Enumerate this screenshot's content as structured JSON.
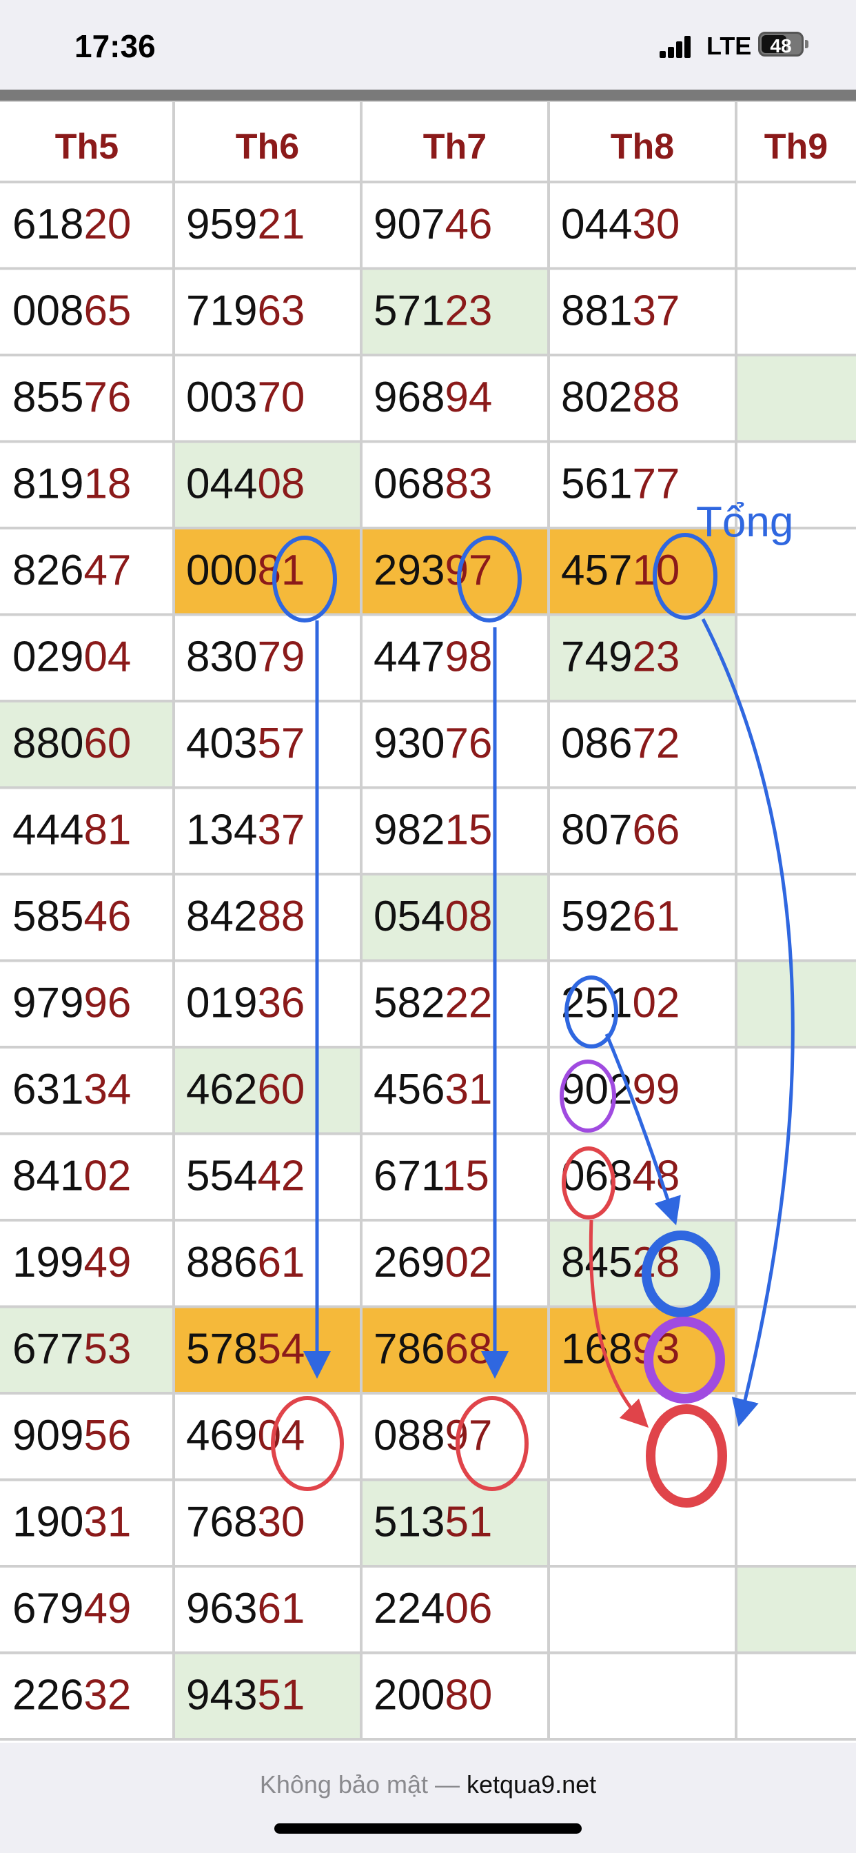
{
  "status_bar": {
    "time": "17:36",
    "network": "LTE",
    "battery": "48"
  },
  "table": {
    "columns": [
      {
        "label": "Th5",
        "values": [
          "61820",
          "00865",
          "85576",
          "81918",
          "82647",
          "02904",
          "88060",
          "44481",
          "58546",
          "97996",
          "63134",
          "84102",
          "19949",
          "67753",
          "90956",
          "19031",
          "67949",
          "22632"
        ]
      },
      {
        "label": "Th6",
        "values": [
          "95921",
          "71963",
          "00370",
          "04408",
          "00081",
          "83079",
          "40357",
          "13437",
          "84288",
          "01936",
          "46260",
          "55442",
          "88661",
          "57854",
          "46904",
          "76830",
          "96361",
          "94351"
        ]
      },
      {
        "label": "Th7",
        "values": [
          "90746",
          "57123",
          "96894",
          "06883",
          "29397",
          "44798",
          "93076",
          "98215",
          "05408",
          "58222",
          "45631",
          "67115",
          "26902",
          "78668",
          "08897",
          "51351",
          "22406",
          "20080"
        ]
      },
      {
        "label": "Th8",
        "values": [
          "04430",
          "88137",
          "80288",
          "56177",
          "45710",
          "74923",
          "08672",
          "80766",
          "59261",
          "25102",
          "90299",
          "06848",
          "84528",
          "16893",
          "",
          "",
          "",
          ""
        ]
      },
      {
        "label": "Th9",
        "values": [
          "",
          "",
          "",
          "",
          "",
          "",
          "",
          "",
          "",
          "",
          "",
          "",
          "",
          "",
          "",
          "",
          "",
          ""
        ]
      }
    ],
    "green_cells": [
      "1-2",
      "3-1",
      "6-0",
      "8-2",
      "10-1",
      "12-3",
      "13-0",
      "15-2",
      "17-1",
      "2-4",
      "9-4",
      "16-4",
      "5-3"
    ],
    "orange_rows": [
      4,
      13
    ],
    "orange_cols": [
      1,
      2,
      3
    ]
  },
  "annotation": {
    "label": "Tổng"
  },
  "colors": {
    "header": "#8b1a1a",
    "digits_head": "#111111",
    "digits_tail": "#8b1a1a",
    "green": "#e2efdc",
    "orange": "#f5b93a",
    "blue": "#2f67e0",
    "purple": "#a04be0",
    "red": "#e0444a"
  },
  "footer": {
    "security": "Không bảo mật —",
    "domain": "ketqua9.net"
  }
}
